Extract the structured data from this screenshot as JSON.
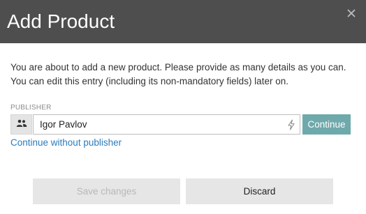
{
  "dialog": {
    "title": "Add Product",
    "close_icon": "close-icon",
    "description_line1": "You are about to add a new product. Please provide as many details as you can.",
    "description_line2": "You can edit this entry (including its non-mandatory fields) later on."
  },
  "publisher": {
    "label": "PUBLISHER",
    "value": "Igor Pavlov",
    "addon_icon": "users-icon",
    "suffix_icon": "lightning-icon",
    "continue_label": "Continue",
    "continue_color": "#6fa9ab",
    "skip_link": "Continue without publisher"
  },
  "footer": {
    "save_label": "Save changes",
    "save_disabled": true,
    "discard_label": "Discard"
  },
  "colors": {
    "header_bg": "#4e4e4e",
    "link": "#2a7bbd"
  }
}
